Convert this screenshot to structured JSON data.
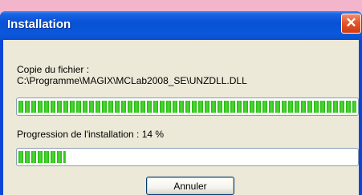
{
  "window": {
    "title": "Installation",
    "close_symbol": "✕"
  },
  "file_copy": {
    "label": "Copie du fichier :",
    "path": "C:\\Programme\\MAGIX\\MCLab2008_SE\\UNZDLL.DLL",
    "progress": 1.0
  },
  "install": {
    "label": "Progression de l'installation : 14 %",
    "progress": 0.14
  },
  "buttons": {
    "cancel_label": "Annuler"
  },
  "colors": {
    "titlebar": "#0852d4",
    "progress_green": "#21b80d",
    "close_red": "#e5552b"
  }
}
